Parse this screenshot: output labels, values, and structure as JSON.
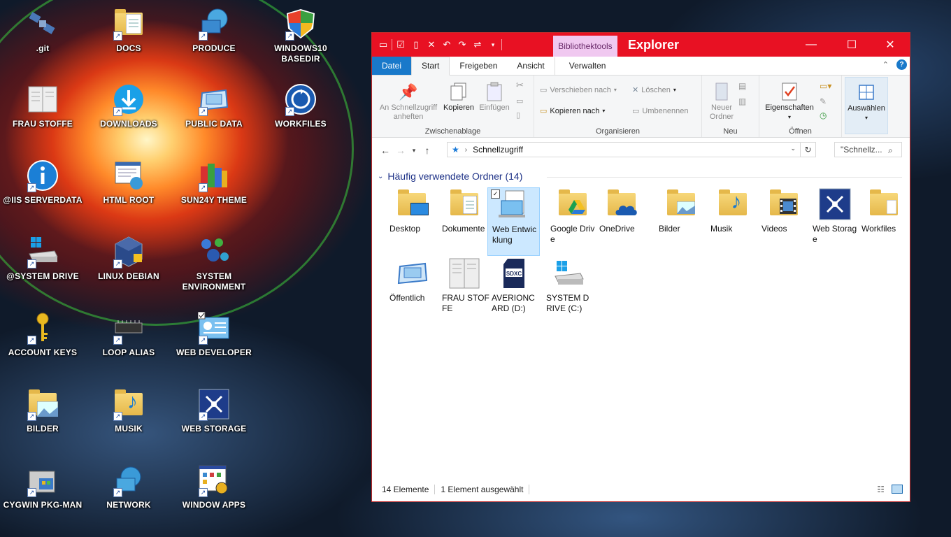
{
  "desktop": {
    "icons": [
      {
        "label": ".git",
        "icon": "satellite-icon"
      },
      {
        "label": "DOCS",
        "icon": "folder-docs-icon"
      },
      {
        "label": "PRODUCE",
        "icon": "globe-monitor-icon"
      },
      {
        "label": "WINDOWS10 BASEDIR",
        "icon": "windows-shield-icon"
      },
      {
        "label": "FRAU STOFFE",
        "icon": "book-icon"
      },
      {
        "label": "DOWNLOADS",
        "icon": "download-icon"
      },
      {
        "label": "PUBLIC DATA",
        "icon": "public-folder-icon"
      },
      {
        "label": "WORKFILES",
        "icon": "sync-icon"
      },
      {
        "label": "@IIS SERVERDATA",
        "icon": "info-icon"
      },
      {
        "label": "HTML ROOT",
        "icon": "html-globe-icon"
      },
      {
        "label": "SUN24Y THEME",
        "icon": "theme-books-icon"
      },
      {
        "label": "@SYSTEM DRIVE",
        "icon": "windows-drive-icon"
      },
      {
        "label": "LINUX DEBIAN",
        "icon": "virtualbox-icon"
      },
      {
        "label": "SYSTEM ENVIRONMENT",
        "icon": "molecules-icon"
      },
      {
        "label": "ACCOUNT KEYS",
        "icon": "key-icon"
      },
      {
        "label": "LOOP ALIAS",
        "icon": "chip-icon"
      },
      {
        "label": "WEB DEVELOPER",
        "icon": "web-developer-icon"
      },
      {
        "label": "BILDER",
        "icon": "pictures-folder-icon"
      },
      {
        "label": "MUSIK",
        "icon": "music-folder-icon"
      },
      {
        "label": "WEB STORAGE",
        "icon": "web-storage-icon"
      },
      {
        "label": "CYGWIN PKG-MAN",
        "icon": "package-icon"
      },
      {
        "label": "NETWORK",
        "icon": "network-globe-icon"
      },
      {
        "label": "WINDOW APPS",
        "icon": "apps-icon"
      }
    ]
  },
  "explorer": {
    "title": "Explorer",
    "context_tab": "Bibliothektools",
    "tabs": {
      "file": "Datei",
      "start": "Start",
      "share": "Freigeben",
      "view": "Ansicht",
      "manage": "Verwalten"
    },
    "ribbon": {
      "pin": "An Schnellzugriff anheften",
      "copy": "Kopieren",
      "paste": "Einfügen",
      "clipboard": "Zwischenablage",
      "move_to": "Verschieben nach",
      "copy_to": "Kopieren nach",
      "delete": "Löschen",
      "rename": "Umbenennen",
      "organize": "Organisieren",
      "new_folder": "Neuer Ordner",
      "new": "Neu",
      "properties": "Eigenschaften",
      "open": "Öffnen",
      "select": "Auswählen"
    },
    "address": {
      "path": "Schnellzugriff",
      "search_placeholder": "\"Schnellz..."
    },
    "section_title": "Häufig verwendete Ordner (14)",
    "items": [
      {
        "label": "Desktop",
        "icon": "desktop-folder-icon"
      },
      {
        "label": "Dokumente",
        "icon": "documents-folder-icon"
      },
      {
        "label": "Web Entwicklung",
        "icon": "web-dev-folder-icon"
      },
      {
        "label": "Google Drive",
        "icon": "google-drive-folder-icon"
      },
      {
        "label": "OneDrive",
        "icon": "onedrive-folder-icon"
      },
      {
        "label": "Bilder",
        "icon": "pictures-folder-icon"
      },
      {
        "label": "Musik",
        "icon": "music-folder-icon"
      },
      {
        "label": "Videos",
        "icon": "videos-folder-icon"
      },
      {
        "label": "Web Storage",
        "icon": "web-storage-icon"
      },
      {
        "label": "Workfiles",
        "icon": "workfiles-folder-icon"
      },
      {
        "label": "Öffentlich",
        "icon": "public-folder-icon"
      },
      {
        "label": "FRAU STOFFE",
        "icon": "book-icon"
      },
      {
        "label": "AVERIONCARD (D:)",
        "icon": "sdxc-card-icon"
      },
      {
        "label": "SYSTEM DRIVE (C:)",
        "icon": "windows-drive-icon"
      }
    ],
    "status": {
      "count": "14 Elemente",
      "selected": "1 Element ausgewählt"
    },
    "colors": {
      "titlebar": "#e81123",
      "accent": "#1979ca",
      "selection": "#cce8ff"
    }
  }
}
